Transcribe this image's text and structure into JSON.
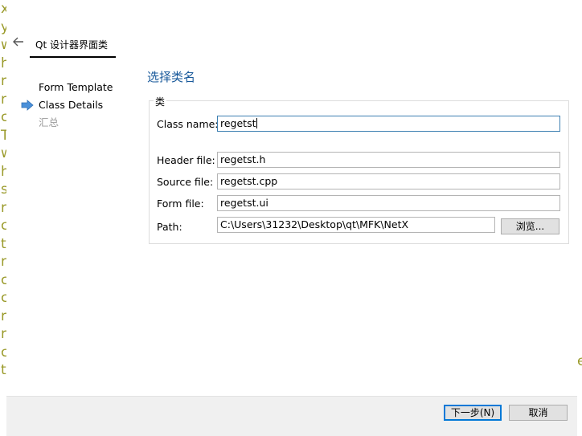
{
  "background_edge_text": [
    "x",
    "y",
    "w",
    "h",
    "r",
    "r",
    "c",
    "T",
    "w",
    "h",
    "s",
    "r",
    "c",
    "t",
    "r",
    "c",
    "c",
    "r",
    "r",
    "c",
    "t"
  ],
  "background_right_text": "e",
  "wizard": {
    "title": "Qt 设计器界面类",
    "steps": [
      {
        "label": "Form Template",
        "state": "done"
      },
      {
        "label": "Class Details",
        "state": "current"
      },
      {
        "label": "汇总",
        "state": "disabled"
      }
    ],
    "page_heading": "选择类名",
    "group_title": "类",
    "fields": {
      "class_name": {
        "label": "Class name:",
        "value": "regetst"
      },
      "header_file": {
        "label": "Header file:",
        "value": "regetst.h"
      },
      "source_file": {
        "label": "Source file:",
        "value": "regetst.cpp"
      },
      "form_file": {
        "label": "Form file:",
        "value": "regetst.ui"
      },
      "path": {
        "label": "Path:",
        "value": "C:\\Users\\31232\\Desktop\\qt\\MFK\\NetX"
      }
    },
    "browse_label": "浏览...",
    "next_label": "下一步(N)",
    "cancel_label": "取消"
  },
  "colors": {
    "heading": "#1a5a9b",
    "arrow": "#4a90d9",
    "default_button_border": "#0078d7"
  }
}
